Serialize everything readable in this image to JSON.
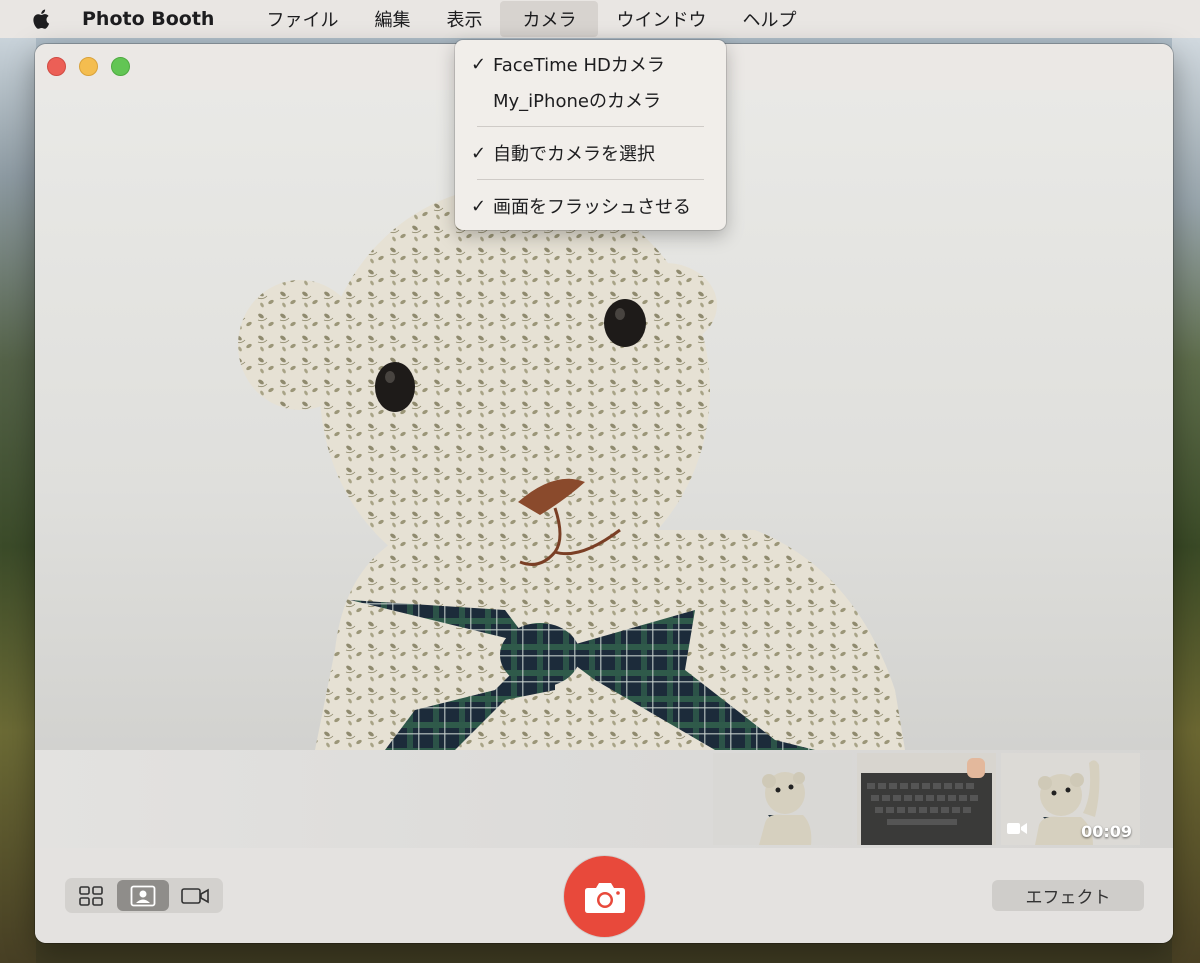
{
  "menubar": {
    "app_name": "Photo Booth",
    "items": [
      {
        "label": "ファイル"
      },
      {
        "label": "編集"
      },
      {
        "label": "表示"
      },
      {
        "label": "カメラ",
        "active": true
      },
      {
        "label": "ウインドウ"
      },
      {
        "label": "ヘルプ"
      }
    ]
  },
  "camera_menu": {
    "items": [
      {
        "label": "FaceTime HDカメラ",
        "checked": true
      },
      {
        "label": "My_iPhoneのカメラ",
        "checked": false
      },
      {
        "label": "自動でカメラを選択",
        "checked": true
      },
      {
        "label": "画面をフラッシュさせる",
        "checked": true
      }
    ],
    "check_mark": "✓"
  },
  "thumbnails": [
    {
      "kind": "photo",
      "subject": "teddy-bear"
    },
    {
      "kind": "photo",
      "subject": "keyboard"
    },
    {
      "kind": "video",
      "subject": "teddy-bear",
      "duration": "00:09"
    }
  ],
  "toolbar": {
    "modes": [
      {
        "icon": "grid-icon",
        "selected": false
      },
      {
        "icon": "portrait-icon",
        "selected": true
      },
      {
        "icon": "video-camera-icon",
        "selected": false
      }
    ],
    "shutter_icon": "camera-icon",
    "effects_label": "エフェクト"
  },
  "colors": {
    "shutter": "#e8493b",
    "close": "#ec5f56",
    "minimize": "#f4bd4f",
    "maximize": "#62c554"
  }
}
